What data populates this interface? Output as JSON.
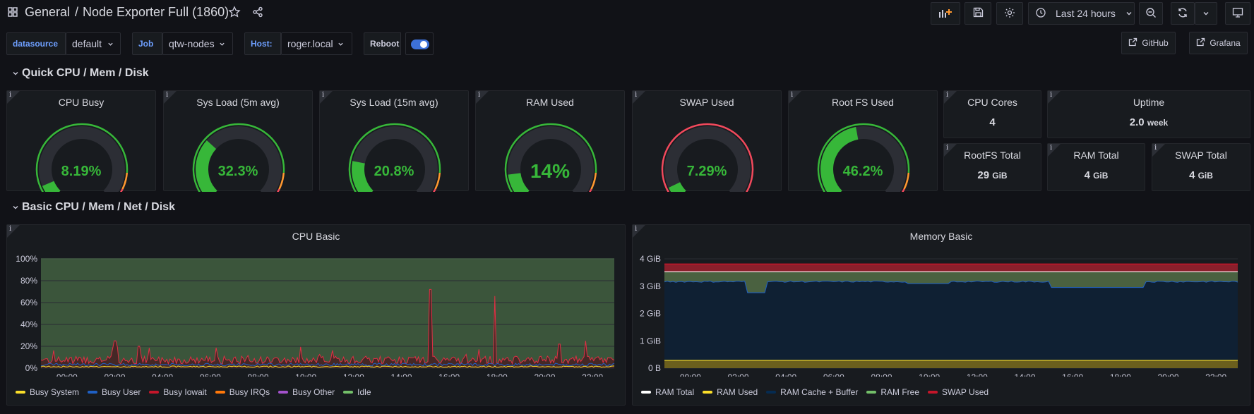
{
  "header": {
    "folder": "General",
    "separator": "/",
    "title": "Node Exporter Full (1860)",
    "time_range": "Last 24 hours"
  },
  "variables": {
    "datasource_label": "datasource",
    "datasource_value": "default",
    "job_label": "Job",
    "job_value": "qtw-nodes",
    "host_label": "Host:",
    "host_value": "roger.local",
    "reboot_label": "Reboot",
    "reboot_on": true
  },
  "links": {
    "github": "GitHub",
    "grafana": "Grafana"
  },
  "rows": {
    "quick": "Quick CPU / Mem / Disk",
    "basic": "Basic CPU / Mem / Net / Disk"
  },
  "gauges": [
    {
      "title": "CPU Busy",
      "value": "8.19%",
      "percent": 8.19,
      "thresholds": "green-orange-red"
    },
    {
      "title": "Sys Load (5m avg)",
      "value": "32.3%",
      "percent": 32.3,
      "thresholds": "green-orange-red"
    },
    {
      "title": "Sys Load (15m avg)",
      "value": "20.8%",
      "percent": 20.8,
      "thresholds": "green-orange-red"
    },
    {
      "title": "RAM Used",
      "value": "14%",
      "percent": 14,
      "thresholds": "green-orange-red"
    },
    {
      "title": "SWAP Used",
      "value": "7.29%",
      "percent": 7.29,
      "thresholds": "red"
    },
    {
      "title": "Root FS Used",
      "value": "46.2%",
      "percent": 46.2,
      "thresholds": "green-orange-red"
    }
  ],
  "stats": {
    "cpu_cores": {
      "title": "CPU Cores",
      "value": "4",
      "unit": ""
    },
    "uptime": {
      "title": "Uptime",
      "value": "2.0",
      "unit": "week"
    },
    "rootfs_total": {
      "title": "RootFS Total",
      "value": "29",
      "unit": "GiB"
    },
    "ram_total": {
      "title": "RAM Total",
      "value": "4",
      "unit": "GiB"
    },
    "swap_total": {
      "title": "SWAP Total",
      "value": "4",
      "unit": "GiB"
    }
  },
  "colors": {
    "green": "#37b739",
    "orange": "#ff9830",
    "red": "#f2495c",
    "yellow": "#fade2a",
    "blue": "#1f60c4",
    "accent": "#3d71d9"
  },
  "chart_data": [
    {
      "type": "area",
      "title": "CPU Basic",
      "ylim": [
        0,
        100
      ],
      "yticks": [
        "0%",
        "20%",
        "40%",
        "60%",
        "80%",
        "100%"
      ],
      "xticks": [
        "00:00",
        "02:00",
        "04:00",
        "06:00",
        "08:00",
        "10:00",
        "12:00",
        "14:00",
        "16:00",
        "18:00",
        "20:00",
        "22:00"
      ],
      "stacked": true,
      "series": [
        {
          "name": "Busy System",
          "color": "#fade2a",
          "typical": 2
        },
        {
          "name": "Busy User",
          "color": "#1f60c4",
          "typical": 3
        },
        {
          "name": "Busy Iowait",
          "color": "#c4162a",
          "typical": 3,
          "spikes": [
            [
              3.1,
              25
            ],
            [
              4.1,
              20
            ],
            [
              16.3,
              72
            ],
            [
              19.0,
              66
            ],
            [
              21.7,
              22
            ],
            [
              22.8,
              25
            ]
          ]
        },
        {
          "name": "Busy IRQs",
          "color": "#ff780a",
          "typical": 0
        },
        {
          "name": "Busy Other",
          "color": "#a352cc",
          "typical": 0
        },
        {
          "name": "Idle",
          "color": "#73bf69",
          "typical": 92
        }
      ],
      "legend_position": "bottom"
    },
    {
      "type": "area",
      "title": "Memory Basic",
      "yticks": [
        "0 B",
        "1 GiB",
        "2 GiB",
        "3 GiB",
        "4 GiB"
      ],
      "ylim": [
        0,
        4.2
      ],
      "xticks": [
        "00:00",
        "02:00",
        "04:00",
        "06:00",
        "08:00",
        "10:00",
        "12:00",
        "14:00",
        "16:00",
        "18:00",
        "20:00",
        "22:00"
      ],
      "stacked": true,
      "series": [
        {
          "name": "RAM Total",
          "color": "#ffffff",
          "value_gib": 3.7
        },
        {
          "name": "RAM Used",
          "color": "#fade2a",
          "value_gib": 0.3
        },
        {
          "name": "RAM Cache + Buffer",
          "color": "#052b51",
          "value_gib": 3.1
        },
        {
          "name": "RAM Free",
          "color": "#73bf69",
          "value_gib": 0.3
        },
        {
          "name": "SWAP Used",
          "color": "#c4162a",
          "value_gib": 0.3
        }
      ],
      "legend_position": "bottom"
    }
  ]
}
